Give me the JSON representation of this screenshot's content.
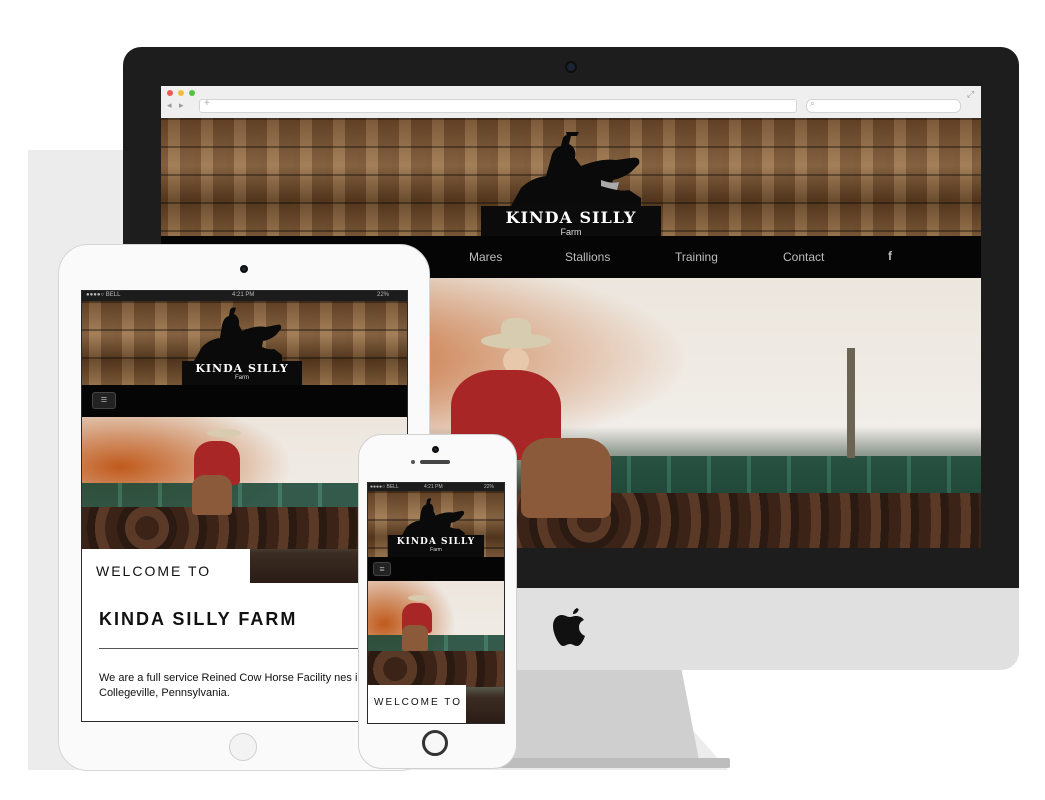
{
  "brand": {
    "title": "KINDA SILLY",
    "subtitle": "Farm"
  },
  "desktop_nav": {
    "items": [
      "Mares",
      "Stallions",
      "Training",
      "Contact"
    ],
    "social_icon": "f"
  },
  "ipad": {
    "status_carrier": "●●●●○ BELL ",
    "status_time": "4:21 PM",
    "status_battery": "22%",
    "menu_icon": "≡",
    "welcome": "WELCOME TO",
    "farm_title": "KINDA SILLY FARM",
    "description": "We are a full service Reined Cow Horse Facility nes in Collegeville, Pennsylvania."
  },
  "iphone": {
    "status_carrier": "●●●●○ BELL",
    "status_time": "4:21 PM",
    "status_battery": "22%",
    "menu_icon": "≡",
    "welcome": "WELCOME TO"
  },
  "icons": {
    "apple_logo": "",
    "browser_back": "◂",
    "browser_forward": "▸",
    "browser_add": "+",
    "browser_search": "⌕",
    "browser_expand": "⤢"
  },
  "colors": {
    "nav_bg": "#050505",
    "accent_red": "#a82626",
    "wood": "#7a5a3a"
  }
}
